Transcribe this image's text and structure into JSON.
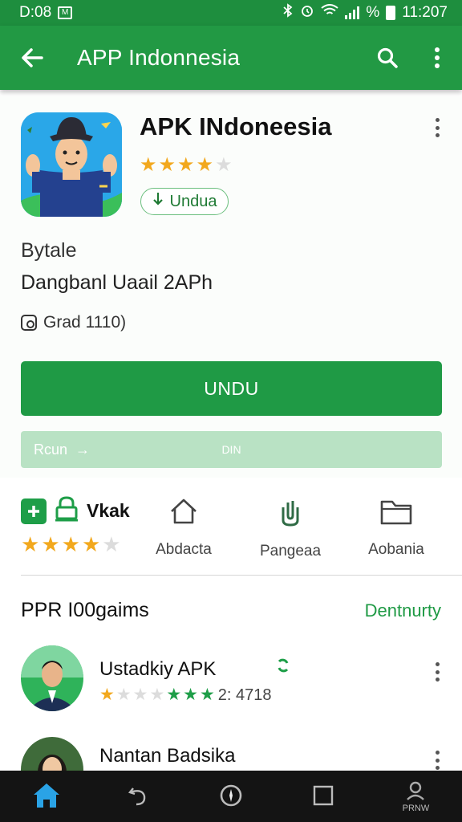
{
  "status_bar": {
    "time_left": "D:08",
    "badge": "M",
    "pct": "%",
    "time_right": "11:207",
    "icons": [
      "bluetooth-icon",
      "alarm-icon",
      "wifi-icon",
      "signal-icon",
      "battery-icon"
    ]
  },
  "app_bar": {
    "title": "APP Indonnesia",
    "icons": [
      "back-arrow-icon",
      "search-icon",
      "more-vert-icon"
    ]
  },
  "app": {
    "name": "APK INdoneesia",
    "rating_stars": 4,
    "chip_label": "Undua",
    "desc_line1": "Bytale",
    "desc_line2": "Dangbanl Uaail 2APh",
    "grade": "Grad 1110)",
    "primary_button": "UNDU",
    "secondary_left": "Rcun",
    "secondary_center": "DIN"
  },
  "quick": {
    "brand_name": "Vkak",
    "brand_stars": 4,
    "items": [
      {
        "label": "Abdacta",
        "icon": "home-icon"
      },
      {
        "label": "Pangeaa",
        "icon": "attach-icon"
      },
      {
        "label": "Aobania",
        "icon": "folder-icon"
      }
    ]
  },
  "section": {
    "title": "PPR I00gaims",
    "more": "Dentnurty",
    "items": [
      {
        "title": "Ustadkiy APK",
        "meta": "2: 4718"
      },
      {
        "title": "Nantan Badsika",
        "meta": ""
      }
    ]
  },
  "nav": {
    "items": [
      "home-icon",
      "back-icon",
      "compass-icon",
      "recent-apps-icon",
      "profile-icon"
    ],
    "profile_label": "PRNW"
  },
  "colors": {
    "accent": "#229944",
    "star": "#f2a81d",
    "star_green": "#1e9e48"
  }
}
